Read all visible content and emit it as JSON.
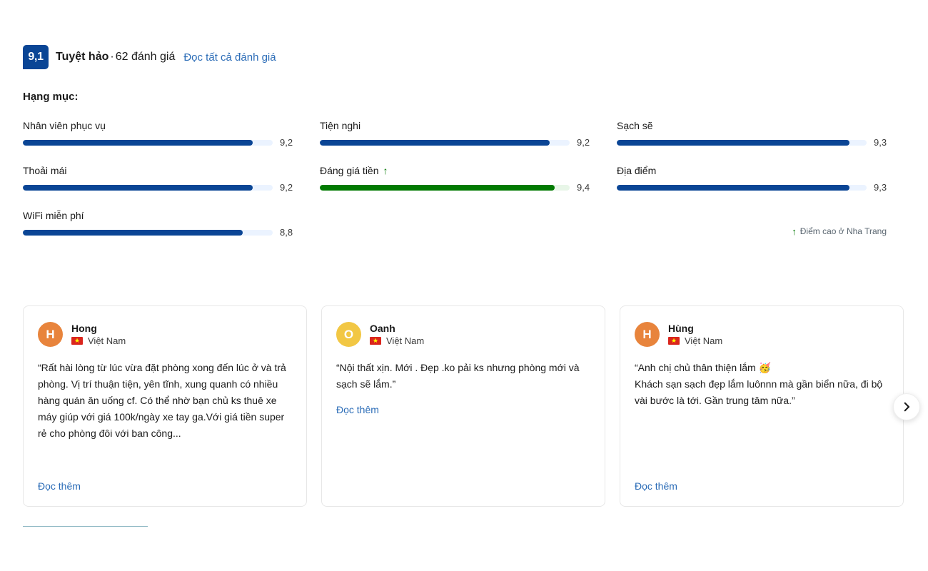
{
  "summary": {
    "score": "9,1",
    "score_word": "Tuyệt hảo",
    "separator": "·",
    "review_count": "62 đánh giá",
    "all_reviews_link": "Đọc tất cả đánh giá",
    "badge_color": "#0a4595",
    "link_color": "#2b6cb7"
  },
  "categories": {
    "title": "Hạng mục:",
    "items": [
      {
        "label": "Nhân viên phục vụ",
        "value": "9,2",
        "percent": 92,
        "highlight": false
      },
      {
        "label": "Tiện nghi",
        "value": "9,2",
        "percent": 92,
        "highlight": false
      },
      {
        "label": "Sạch sẽ",
        "value": "9,3",
        "percent": 93,
        "highlight": false
      },
      {
        "label": "Thoải mái",
        "value": "9,2",
        "percent": 92,
        "highlight": false
      },
      {
        "label": "Đáng giá tiền",
        "value": "9,4",
        "percent": 94,
        "highlight": true
      },
      {
        "label": "Địa điểm",
        "value": "9,3",
        "percent": 93,
        "highlight": false
      },
      {
        "label": "WiFi miễn phí",
        "value": "8,8",
        "percent": 88,
        "highlight": false
      }
    ],
    "highlight_color": "#017a01",
    "bar_color": "#0a4595"
  },
  "city_note": {
    "text": "Điểm cao ở Nha Trang",
    "arrow": "↑"
  },
  "reviews": [
    {
      "initial": "H",
      "name": "Hong",
      "country": "Việt Nam",
      "avatar_color": "#e8843c",
      "text": "“Rất hài lòng từ lúc vừa đặt phòng xong đến lúc ở và trả phòng. Vị trí thuận tiện, yên tĩnh, xung quanh có nhiều hàng quán ăn uống cf. Có thể nhờ bạn chủ ks thuê xe máy giúp với giá 100k/ngày xe tay ga.Với giá tiền super rẻ cho phòng đôi với ban công...",
      "read_more": "Đọc thêm"
    },
    {
      "initial": "O",
      "name": "Oanh",
      "country": "Việt Nam",
      "avatar_color": "#f2c744",
      "text": "“Nội thất xịn. Mới . Đẹp .ko pải ks nhưng phòng mới và sạch sẽ lắm.”",
      "read_more": "Đọc thêm"
    },
    {
      "initial": "H",
      "name": "Hùng",
      "country": "Việt Nam",
      "avatar_color": "#e8843c",
      "text": "“Anh chị chủ thân thiện lắm 🥳\nKhách sạn sạch đẹp lắm luônnn mà gần biển nữa, đi bộ vài bước là tới. Gần trung tâm nữa.”",
      "read_more": "Đọc thêm"
    }
  ],
  "carousel": {
    "next_label": "›"
  }
}
